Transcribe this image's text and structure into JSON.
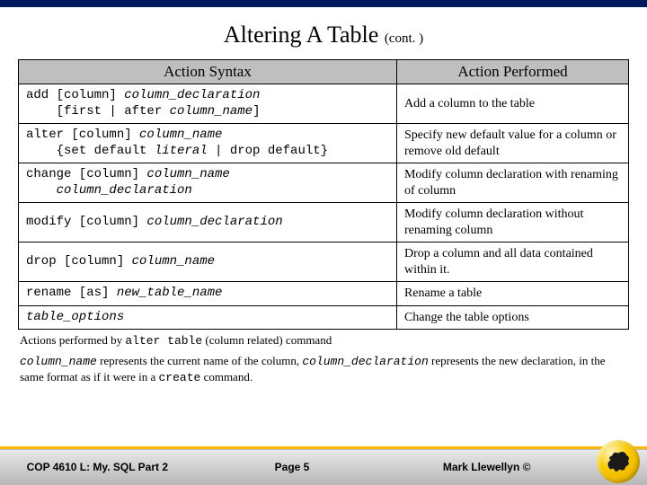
{
  "title_main": "Altering A Table ",
  "title_cont": "(cont. )",
  "headers": {
    "syntax": "Action Syntax",
    "performed": "Action Performed"
  },
  "rows": [
    {
      "syntax_html": "add [column] <span class=\"sit\">column_declaration</span>\n    [first | after <span class=\"sit\">column_name</span>]",
      "performed": "Add a column to the table"
    },
    {
      "syntax_html": "alter [column] <span class=\"sit\">column_name</span>\n    {set default <span class=\"sit\">literal</span> | drop default}",
      "performed": "Specify new default value for a column or remove old default"
    },
    {
      "syntax_html": "change [column] <span class=\"sit\">column_name</span>\n    <span class=\"sit\">column_declaration</span>",
      "performed": "Modify column declaration with renaming of column"
    },
    {
      "syntax_html": "modify [column] <span class=\"sit\">column_declaration</span>",
      "performed": "Modify column declaration without renaming column"
    },
    {
      "syntax_html": "drop [column] <span class=\"sit\">column_name</span>",
      "performed": "Drop a column and all data contained within it."
    },
    {
      "syntax_html": "rename [as] <span class=\"sit\">new_table_name</span>",
      "performed": "Rename a table"
    },
    {
      "syntax_html": "<span class=\"sit\">table_options</span>",
      "performed": "Change the table options"
    }
  ],
  "note1_html": "Actions performed by <span class=\"code\">alter table</span> (column related) command",
  "note2_html": "<span class=\"icode\">column_name</span> represents the current name of the column, <span class=\"icode\">column_declaration</span> represents the new declaration, in the same format as if it were in a <span class=\"code\">create</span> command.",
  "footer": {
    "left": "COP 4610 L: My. SQL Part 2",
    "center": "Page 5",
    "right": "Mark Llewellyn ©"
  }
}
